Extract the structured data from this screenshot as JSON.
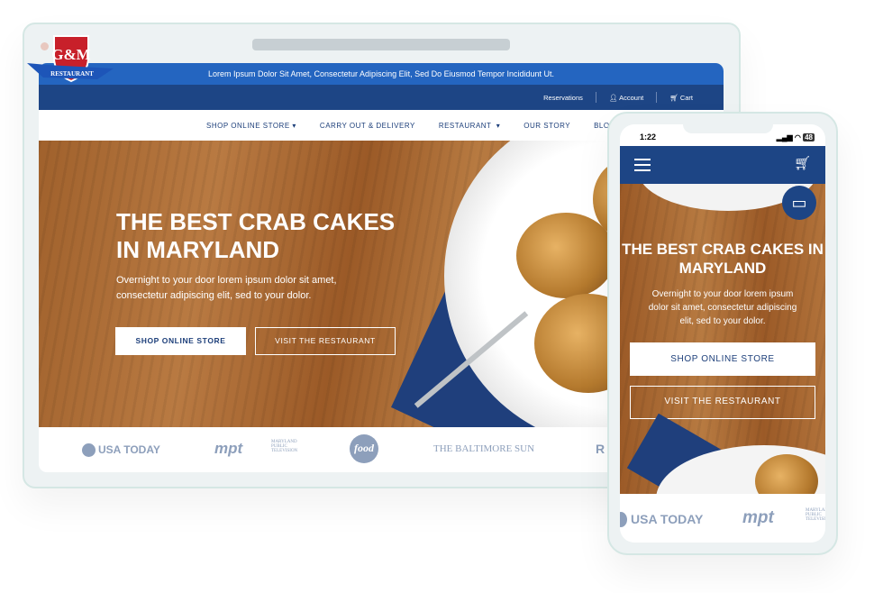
{
  "desktop": {
    "promo": "Lorem Ipsum Dolor Sit Amet, Consectetur Adipiscing Elit, Sed Do Eiusmod Tempor Incididunt Ut.",
    "util": {
      "reservations": "Reservations",
      "account": "Account",
      "cart": "Cart"
    },
    "nav": [
      "SHOP ONLINE STORE",
      "CARRY OUT & DELIVERY",
      "RESTAURANT",
      "OUR STORY",
      "BLOG"
    ],
    "hero": {
      "title": "THE BEST CRAB CAKES IN MARYLAND",
      "subtitle": "Overnight to your door lorem ipsum dolor sit amet, consectetur adipiscing elit, sed to your dolor.",
      "primary": "SHOP ONLINE STORE",
      "secondary": "VISIT THE RESTAURANT"
    },
    "logos": [
      "USA TODAY",
      "mpt",
      "MARYLAND PUBLIC TELEVISION",
      "food",
      "THE BALTIMORE SUN",
      "R"
    ]
  },
  "brand": {
    "logo_text": "G&M",
    "logo_ribbon": "RESTAURANT"
  },
  "mobile": {
    "time": "1:22",
    "battery": "48",
    "hero": {
      "title": "THE BEST CRAB CAKES IN MARYLAND",
      "subtitle": "Overnight to your door lorem ipsum dolor sit amet, consectetur adipiscing elit, sed to your dolor.",
      "primary": "SHOP ONLINE STORE",
      "secondary": "VISIT THE RESTAURANT"
    },
    "logos": [
      "USA TODAY",
      "mpt",
      "MARYLAND PUBLIC TELEVISION"
    ]
  },
  "colors": {
    "navy": "#1d4585",
    "blue": "#2465c0",
    "logo_gray": "#8d9fbb",
    "logo_red": "#c8202a"
  }
}
